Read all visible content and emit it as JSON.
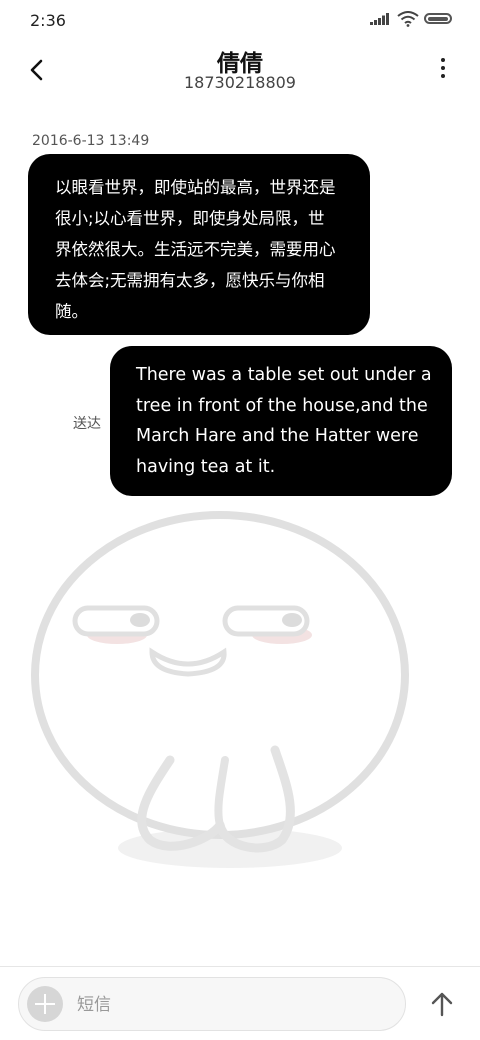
{
  "status_bar": {
    "time": "2:36"
  },
  "header": {
    "contact_name": "倩倩",
    "phone_number": "18730218809"
  },
  "conversation": {
    "timestamp": "2016-6-13 13:49",
    "incoming_message": "以眼看世界，即使站的最高，世界还是很小;以心看世界，即使身处局限，世界依然很大。生活远不完美，需要用心去体会;无需拥有太多，愿快乐与你相随。",
    "outgoing_message": "There was a table set out under a tree in front of the house,and the March Hare and the Hatter were having tea at it.",
    "delivery_status": "送达"
  },
  "composer": {
    "placeholder": "短信"
  },
  "icons": {
    "back": "back-arrow-icon",
    "more": "more-vertical-icon",
    "add": "plus-icon",
    "send": "send-arrow-up-icon"
  }
}
